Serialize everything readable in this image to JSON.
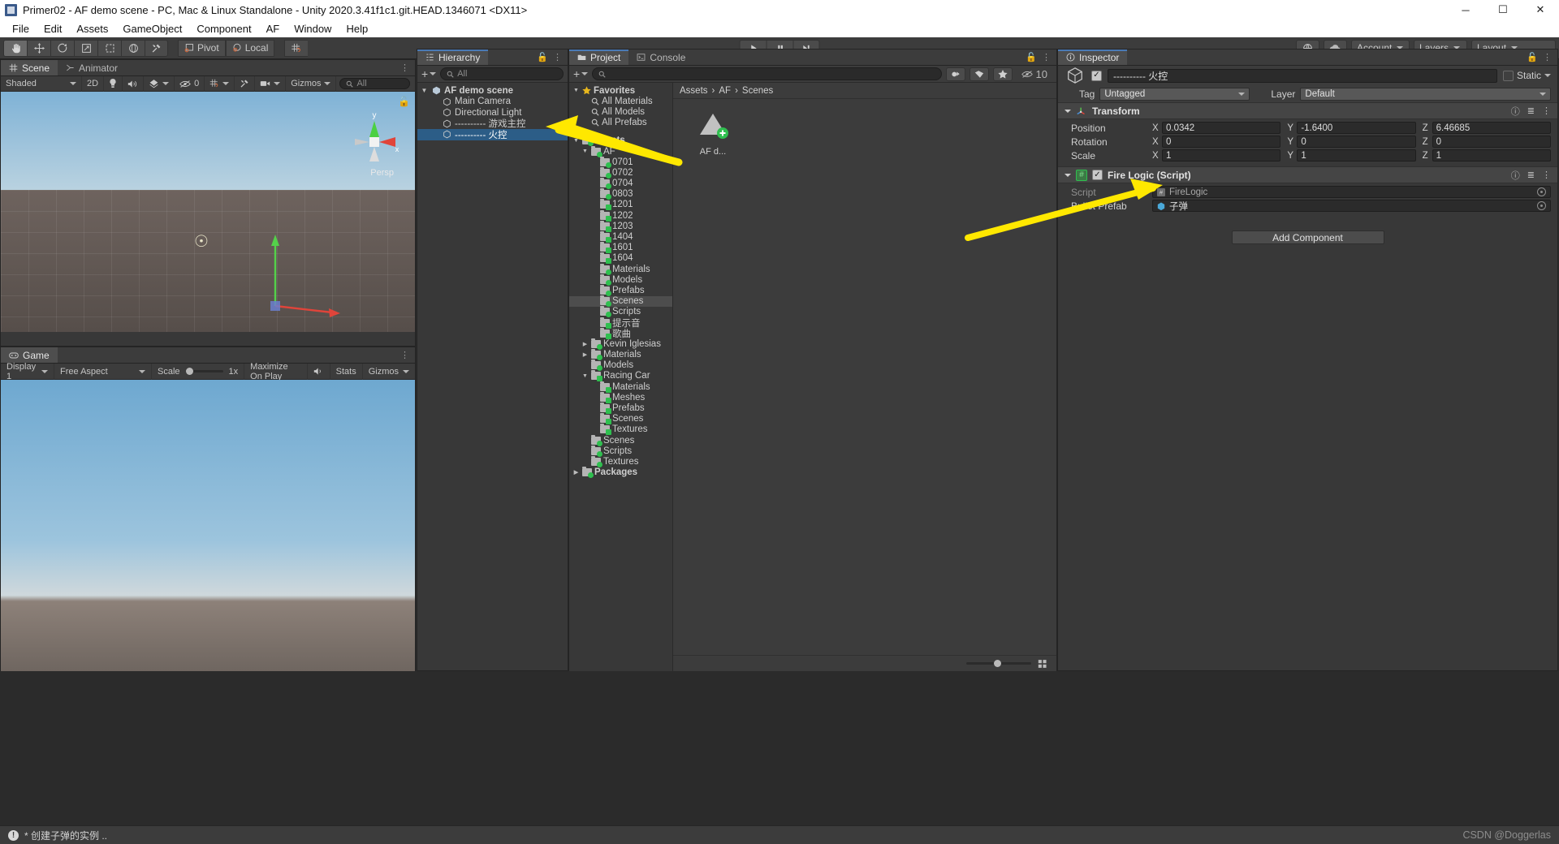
{
  "window": {
    "title": "Primer02 - AF demo scene - PC, Mac & Linux Standalone - Unity 2020.3.41f1c1.git.HEAD.1346071 <DX11>",
    "minimize": "─",
    "maximize": "☐",
    "close": "✕"
  },
  "menu": {
    "items": [
      "File",
      "Edit",
      "Assets",
      "GameObject",
      "Component",
      "AF",
      "Window",
      "Help"
    ]
  },
  "toolbar": {
    "tools": [
      "hand-tool",
      "move-tool",
      "rotate-tool",
      "scale-tool",
      "rect-tool",
      "transform-tool",
      "custom-tool"
    ],
    "pivot_label": "Pivot",
    "local_label": "Local",
    "grid_label": "grid-snap",
    "play": "▶",
    "pause": "❚❚",
    "step": "▶❚",
    "cloud_label": "cloud-icon",
    "account_label": "Account",
    "layers_label": "Layers",
    "layout_label": "Layout",
    "collab_label": "collab-icon"
  },
  "scene": {
    "tabs": [
      {
        "label": "Scene",
        "icon": "grid-icon",
        "active": true
      },
      {
        "label": "Animator",
        "icon": "animator-icon",
        "active": false
      }
    ],
    "toolbar": {
      "shading": "Shaded",
      "mode_2d": "2D",
      "lighting": "lighting-icon",
      "audio": "audio-icon",
      "fx": "effects-icon",
      "hidden_count": "0",
      "grid": "grid-visibility-icon",
      "tools": "scene-tools-icon",
      "camera": "scene-camera-icon",
      "gizmos": "Gizmos",
      "search_placeholder": "All"
    },
    "persp_label": "Persp",
    "axis_labels": {
      "y": "y",
      "x": "x"
    }
  },
  "game": {
    "tabs": [
      {
        "label": "Game",
        "icon": "game-icon",
        "active": true
      }
    ],
    "toolbar": {
      "display": "Display 1",
      "aspect": "Free Aspect",
      "scale_label": "Scale",
      "scale_value": "1x",
      "maximize": "Maximize On Play",
      "mute": "mute-audio-icon",
      "stats": "Stats",
      "gizmos": "Gizmos"
    }
  },
  "hierarchy": {
    "tab_label": "Hierarchy",
    "tab_icon": "hierarchy-icon",
    "add_label": "+",
    "search_placeholder": "All",
    "items": [
      {
        "label": "AF demo scene",
        "depth": 0,
        "icon": "scene-icon",
        "expanded": true,
        "selected": false,
        "bold": true
      },
      {
        "label": "Main Camera",
        "depth": 1,
        "icon": "gameobject-icon",
        "expanded": false,
        "selected": false,
        "bold": false
      },
      {
        "label": "Directional Light",
        "depth": 1,
        "icon": "gameobject-icon",
        "expanded": false,
        "selected": false,
        "bold": false
      },
      {
        "label": "---------- 游戏主控",
        "depth": 1,
        "icon": "gameobject-icon",
        "expanded": false,
        "selected": false,
        "bold": false
      },
      {
        "label": "---------- 火控",
        "depth": 1,
        "icon": "gameobject-icon",
        "expanded": false,
        "selected": true,
        "bold": false
      }
    ]
  },
  "project": {
    "tabs": [
      {
        "label": "Project",
        "icon": "project-icon",
        "active": true
      },
      {
        "label": "Console",
        "icon": "console-icon",
        "active": false
      }
    ],
    "add_label": "+",
    "search_placeholder": "",
    "filter_icons": [
      "type-filter-icon",
      "label-filter-icon",
      "favorite-filter-icon"
    ],
    "hidden_count": "10",
    "tree": [
      {
        "label": "Favorites",
        "depth": 0,
        "icon": "star-icon",
        "tri": "down",
        "bold": true
      },
      {
        "label": "All Materials",
        "depth": 1,
        "icon": "search-icon",
        "tri": "",
        "bold": false
      },
      {
        "label": "All Models",
        "depth": 1,
        "icon": "search-icon",
        "tri": "",
        "bold": false
      },
      {
        "label": "All Prefabs",
        "depth": 1,
        "icon": "search-icon",
        "tri": "",
        "bold": false
      },
      {
        "label": "",
        "depth": 0,
        "icon": "spacer",
        "tri": "",
        "bold": false
      },
      {
        "label": "Assets",
        "depth": 0,
        "icon": "folder-green",
        "tri": "down",
        "bold": true
      },
      {
        "label": "AF",
        "depth": 1,
        "icon": "folder-green",
        "tri": "down",
        "bold": false
      },
      {
        "label": "0701",
        "depth": 2,
        "icon": "folder-green",
        "tri": "",
        "bold": false
      },
      {
        "label": "0702",
        "depth": 2,
        "icon": "folder-green",
        "tri": "",
        "bold": false
      },
      {
        "label": "0704",
        "depth": 2,
        "icon": "folder-green",
        "tri": "",
        "bold": false
      },
      {
        "label": "0803",
        "depth": 2,
        "icon": "folder-green",
        "tri": "",
        "bold": false
      },
      {
        "label": "1201",
        "depth": 2,
        "icon": "folder-greensq",
        "tri": "",
        "bold": false
      },
      {
        "label": "1202",
        "depth": 2,
        "icon": "folder-greensq",
        "tri": "",
        "bold": false
      },
      {
        "label": "1203",
        "depth": 2,
        "icon": "folder-greensq",
        "tri": "",
        "bold": false
      },
      {
        "label": "1404",
        "depth": 2,
        "icon": "folder-greensq",
        "tri": "",
        "bold": false
      },
      {
        "label": "1601",
        "depth": 2,
        "icon": "folder-greensq",
        "tri": "",
        "bold": false
      },
      {
        "label": "1604",
        "depth": 2,
        "icon": "folder-greensq",
        "tri": "",
        "bold": false
      },
      {
        "label": "Materials",
        "depth": 2,
        "icon": "folder-green",
        "tri": "",
        "bold": false
      },
      {
        "label": "Models",
        "depth": 2,
        "icon": "folder-green",
        "tri": "",
        "bold": false
      },
      {
        "label": "Prefabs",
        "depth": 2,
        "icon": "folder-green",
        "tri": "",
        "bold": false
      },
      {
        "label": "Scenes",
        "depth": 2,
        "icon": "folder-green",
        "tri": "",
        "bold": false,
        "selected": true
      },
      {
        "label": "Scripts",
        "depth": 2,
        "icon": "folder-green",
        "tri": "",
        "bold": false
      },
      {
        "label": "提示音",
        "depth": 2,
        "icon": "folder-greensq",
        "tri": "",
        "bold": false
      },
      {
        "label": "歌曲",
        "depth": 2,
        "icon": "folder-greensq",
        "tri": "",
        "bold": false
      },
      {
        "label": "Kevin Iglesias",
        "depth": 1,
        "icon": "folder-green",
        "tri": "right",
        "bold": false
      },
      {
        "label": "Materials",
        "depth": 1,
        "icon": "folder-green",
        "tri": "right",
        "bold": false
      },
      {
        "label": "Models",
        "depth": 1,
        "icon": "folder-green",
        "tri": "",
        "bold": false
      },
      {
        "label": "Racing Car",
        "depth": 1,
        "icon": "folder-greensq",
        "tri": "down",
        "bold": false
      },
      {
        "label": "Materials",
        "depth": 2,
        "icon": "folder-greensq",
        "tri": "",
        "bold": false
      },
      {
        "label": "Meshes",
        "depth": 2,
        "icon": "folder-greensq",
        "tri": "",
        "bold": false
      },
      {
        "label": "Prefabs",
        "depth": 2,
        "icon": "folder-greensq",
        "tri": "",
        "bold": false
      },
      {
        "label": "Scenes",
        "depth": 2,
        "icon": "folder-greensq",
        "tri": "",
        "bold": false
      },
      {
        "label": "Textures",
        "depth": 2,
        "icon": "folder-greensq",
        "tri": "",
        "bold": false
      },
      {
        "label": "Scenes",
        "depth": 1,
        "icon": "folder-green",
        "tri": "",
        "bold": false
      },
      {
        "label": "Scripts",
        "depth": 1,
        "icon": "folder-green",
        "tri": "",
        "bold": false
      },
      {
        "label": "Textures",
        "depth": 1,
        "icon": "folder-green",
        "tri": "",
        "bold": false
      },
      {
        "label": "Packages",
        "depth": 0,
        "icon": "folder-green",
        "tri": "right",
        "bold": true
      }
    ],
    "breadcrumb": [
      "Assets",
      "AF",
      "Scenes"
    ],
    "assets": [
      {
        "label": "AF d...",
        "icon": "scene-asset-icon"
      }
    ],
    "zoom_value": "42"
  },
  "inspector": {
    "tab_label": "Inspector",
    "tab_icon": "info-icon",
    "lock_icon": "lock-icon",
    "menu_icon": "kebab-icon",
    "object_name": "---------- 火控",
    "enabled": true,
    "static_label": "Static",
    "static_checked": false,
    "tag_label": "Tag",
    "tag_value": "Untagged",
    "layer_label": "Layer",
    "layer_value": "Default",
    "transform": {
      "title": "Transform",
      "icon": "transform-icon",
      "rows": [
        {
          "label": "Position",
          "x": "0.0342",
          "y": "-1.6400",
          "z": "6.46685"
        },
        {
          "label": "Rotation",
          "x": "0",
          "y": "0",
          "z": "0"
        },
        {
          "label": "Scale",
          "x": "1",
          "y": "1",
          "z": "1"
        }
      ]
    },
    "fire_logic": {
      "title": "Fire Logic (Script)",
      "icon": "script-icon",
      "enabled": true,
      "props": [
        {
          "label": "Script",
          "value": "FireLogic",
          "icon": "cs-script-icon",
          "dim": true
        },
        {
          "label": "Bullet Prefab",
          "value": "子弹",
          "icon": "prefab-icon",
          "dim": false
        }
      ]
    },
    "add_component": "Add Component"
  },
  "status": {
    "icon": "error-icon",
    "message": "* 创建子弹的实例 .."
  },
  "watermark": "CSDN @Doggerlas",
  "colors": {
    "selection_blue": "#2c5d87",
    "arrow_yellow": "#ffe800",
    "panel_bg": "#383838",
    "toolbar_bg": "#3c3c3c",
    "accent_green": "#2fbf4f"
  }
}
